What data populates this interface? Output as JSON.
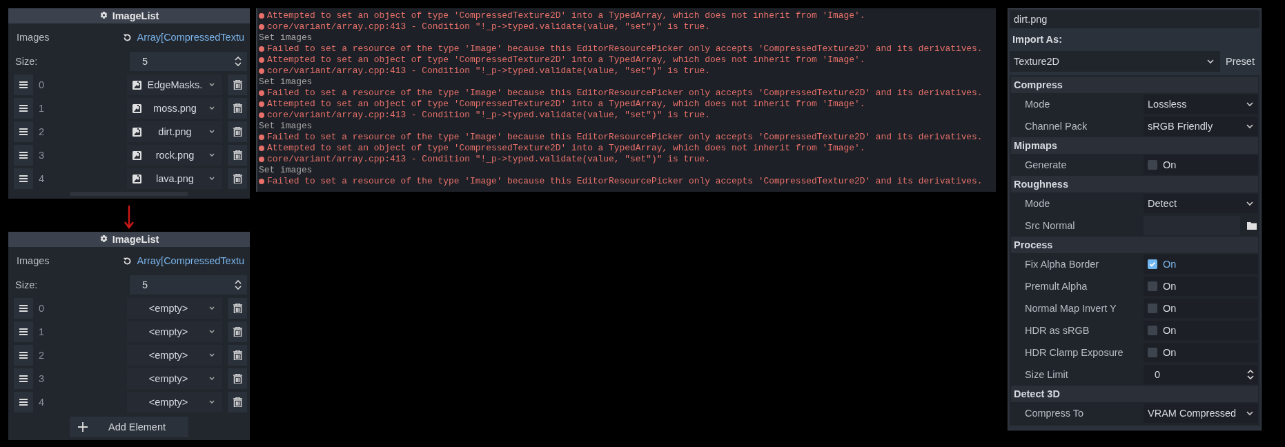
{
  "inspectors": [
    {
      "title": "ImageList",
      "property": "Images",
      "value": "Array[CompressedTextu",
      "size_label": "Size:",
      "size": "5",
      "items": [
        {
          "index": "0",
          "kind": "resource",
          "value": "EdgeMasks."
        },
        {
          "index": "1",
          "kind": "resource",
          "value": "moss.png"
        },
        {
          "index": "2",
          "kind": "resource",
          "value": "dirt.png"
        },
        {
          "index": "3",
          "kind": "resource",
          "value": "rock.png"
        },
        {
          "index": "4",
          "kind": "resource",
          "value": "lava.png"
        }
      ]
    },
    {
      "title": "ImageList",
      "property": "Images",
      "value": "Array[CompressedTextu",
      "size_label": "Size:",
      "size": "5",
      "items": [
        {
          "index": "0",
          "kind": "empty",
          "value": "<empty>"
        },
        {
          "index": "1",
          "kind": "empty",
          "value": "<empty>"
        },
        {
          "index": "2",
          "kind": "empty",
          "value": "<empty>"
        },
        {
          "index": "3",
          "kind": "empty",
          "value": "<empty>"
        },
        {
          "index": "4",
          "kind": "empty",
          "value": "<empty>"
        }
      ],
      "add_button": "Add Element"
    }
  ],
  "log": [
    {
      "kind": "error",
      "text": "Attempted to set an object of type 'CompressedTexture2D' into a TypedArray, which does not inherit from 'Image'."
    },
    {
      "kind": "error",
      "text": "core/variant/array.cpp:413 - Condition \"!_p->typed.validate(value, \"set\")\" is true."
    },
    {
      "kind": "info",
      "text": "Set images"
    },
    {
      "kind": "error",
      "text": "Failed to set a resource of the type 'Image' because this EditorResourcePicker only accepts 'CompressedTexture2D' and its derivatives."
    },
    {
      "kind": "error",
      "text": "Attempted to set an object of type 'CompressedTexture2D' into a TypedArray, which does not inherit from 'Image'."
    },
    {
      "kind": "error",
      "text": "core/variant/array.cpp:413 - Condition \"!_p->typed.validate(value, \"set\")\" is true."
    },
    {
      "kind": "info",
      "text": "Set images"
    },
    {
      "kind": "error",
      "text": "Failed to set a resource of the type 'Image' because this EditorResourcePicker only accepts 'CompressedTexture2D' and its derivatives."
    },
    {
      "kind": "error",
      "text": "Attempted to set an object of type 'CompressedTexture2D' into a TypedArray, which does not inherit from 'Image'."
    },
    {
      "kind": "error",
      "text": "core/variant/array.cpp:413 - Condition \"!_p->typed.validate(value, \"set\")\" is true."
    },
    {
      "kind": "info",
      "text": "Set images"
    },
    {
      "kind": "error",
      "text": "Failed to set a resource of the type 'Image' because this EditorResourcePicker only accepts 'CompressedTexture2D' and its derivatives."
    },
    {
      "kind": "error",
      "text": "Attempted to set an object of type 'CompressedTexture2D' into a TypedArray, which does not inherit from 'Image'."
    },
    {
      "kind": "error",
      "text": "core/variant/array.cpp:413 - Condition \"!_p->typed.validate(value, \"set\")\" is true."
    },
    {
      "kind": "info",
      "text": "Set images"
    },
    {
      "kind": "error",
      "text": "Failed to set a resource of the type 'Image' because this EditorResourcePicker only accepts 'CompressedTexture2D' and its derivatives."
    }
  ],
  "import": {
    "file": "dirt.png",
    "import_as_label": "Import As:",
    "type": "Texture2D",
    "preset": "Preset",
    "sections": [
      {
        "title": "Compress",
        "rows": [
          {
            "kind": "select",
            "label": "Mode",
            "value": "Lossless"
          },
          {
            "kind": "select",
            "label": "Channel Pack",
            "value": "sRGB Friendly"
          }
        ]
      },
      {
        "title": "Mipmaps",
        "rows": [
          {
            "kind": "check",
            "label": "Generate",
            "checked": false,
            "text": "On"
          }
        ]
      },
      {
        "title": "Roughness",
        "rows": [
          {
            "kind": "select",
            "label": "Mode",
            "value": "Detect"
          },
          {
            "kind": "file",
            "label": "Src Normal"
          }
        ]
      },
      {
        "title": "Process",
        "rows": [
          {
            "kind": "check",
            "label": "Fix Alpha Border",
            "checked": true,
            "text": "On"
          },
          {
            "kind": "check",
            "label": "Premult Alpha",
            "checked": false,
            "text": "On"
          },
          {
            "kind": "check",
            "label": "Normal Map Invert Y",
            "checked": false,
            "text": "On"
          },
          {
            "kind": "check",
            "label": "HDR as sRGB",
            "checked": false,
            "text": "On"
          },
          {
            "kind": "check",
            "label": "HDR Clamp Exposure",
            "checked": false,
            "text": "On"
          },
          {
            "kind": "spin",
            "label": "Size Limit",
            "value": "0"
          }
        ]
      },
      {
        "title": "Detect 3D",
        "rows": [
          {
            "kind": "select",
            "label": "Compress To",
            "value": "VRAM Compressed"
          }
        ]
      }
    ]
  }
}
